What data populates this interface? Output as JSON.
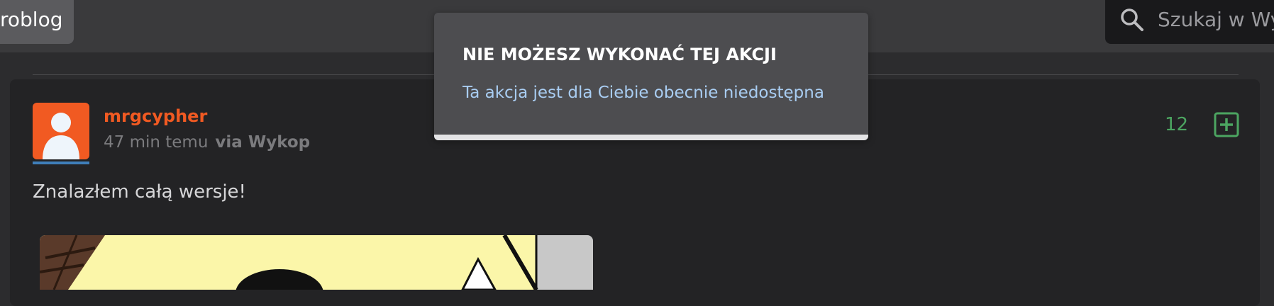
{
  "header": {
    "active_tab": "Mikroblog",
    "active_tab_visible": "roblog",
    "search_placeholder": "Szukaj w Wykopie",
    "search_placeholder_visible": "Szukaj w Wy"
  },
  "toast": {
    "title": "NIE MOŻESZ WYKONAĆ TEJ AKCJI",
    "message": "Ta akcja jest dla Ciebie obecnie niedostępna"
  },
  "entry": {
    "username": "mrgcypher",
    "time": "47 min temu",
    "via": "via Wykop",
    "votes": "12",
    "text": "Znalazłem całą wersje!"
  },
  "colors": {
    "accent": "#f15a22",
    "vote_green": "#4ca561",
    "link_blue": "#a9cdf2"
  },
  "icons": {
    "search": "search-icon",
    "plus": "plus-square-icon",
    "avatar": "default-avatar-icon"
  }
}
